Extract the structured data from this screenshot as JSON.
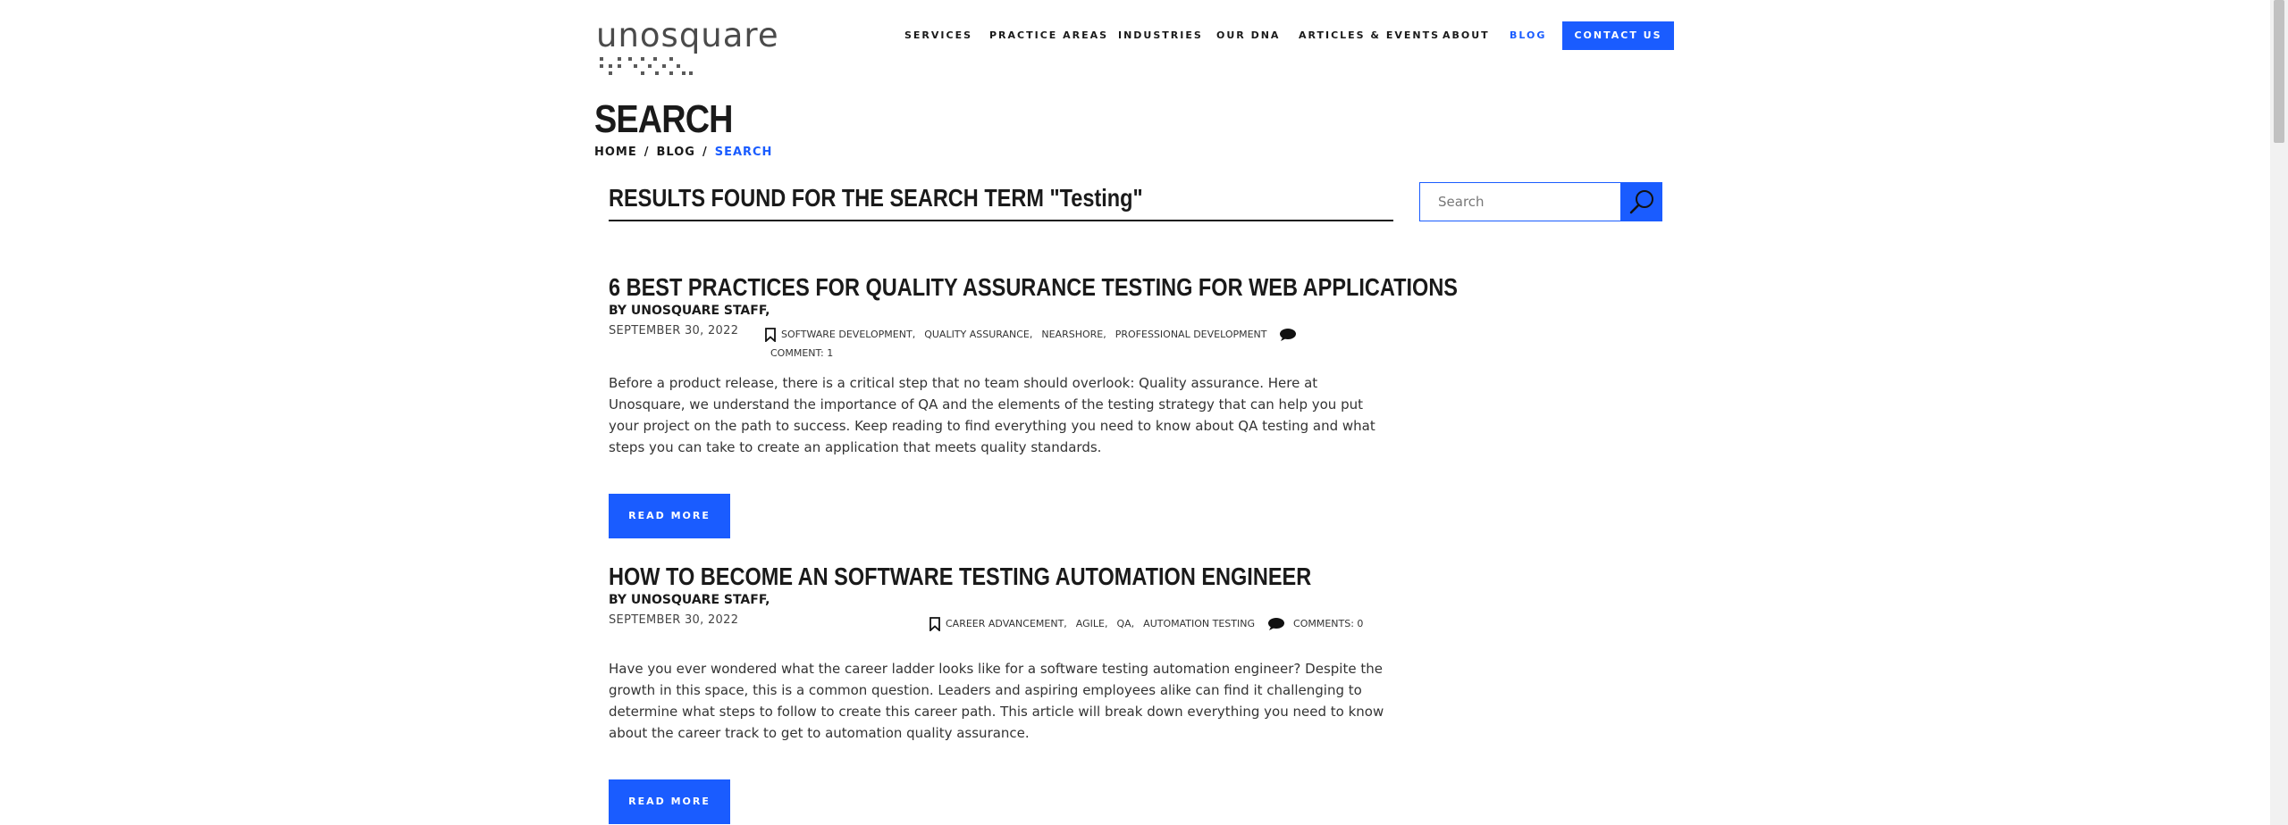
{
  "header": {
    "logo_text": "unosquare",
    "nav": [
      {
        "label": "SERVICES",
        "active": false
      },
      {
        "label": "PRACTICE AREAS",
        "active": false
      },
      {
        "label": "INDUSTRIES",
        "active": false
      },
      {
        "label": "OUR DNA",
        "active": false
      },
      {
        "label": "ARTICLES & EVENTS",
        "active": false
      },
      {
        "label": "ABOUT",
        "active": false
      },
      {
        "label": "BLOG",
        "active": true
      }
    ],
    "contact_label": "CONTACT US"
  },
  "page": {
    "title": "SEARCH",
    "breadcrumb": [
      "HOME",
      "BLOG",
      "SEARCH"
    ],
    "breadcrumb_separator": "/"
  },
  "results": {
    "heading": "RESULTS FOUND FOR THE SEARCH TERM \"Testing\""
  },
  "search": {
    "placeholder": "Search",
    "value": ""
  },
  "articles": [
    {
      "title": "6 BEST PRACTICES FOR QUALITY ASSURANCE TESTING FOR WEB APPLICATIONS",
      "byline": "BY UNOSQUARE STAFF,",
      "date": "SEPTEMBER 30, 2022",
      "tags": [
        "SOFTWARE DEVELOPMENT",
        "QUALITY ASSURANCE",
        "NEARSHORE",
        "PROFESSIONAL DEVELOPMENT"
      ],
      "comments": "COMMENT: 1",
      "excerpt": "Before a product release, there is a critical step that no team should overlook: Quality assurance. Here at Unosquare, we understand the importance of QA and the elements of the testing strategy that can help you put your project on the path to success. Keep reading to find everything you need to know about QA testing and what steps you can take to create an application that meets quality standards.",
      "read_more": "READ MORE"
    },
    {
      "title": "HOW TO BECOME AN SOFTWARE TESTING AUTOMATION ENGINEER",
      "byline": "BY UNOSQUARE STAFF,",
      "date": "SEPTEMBER 30, 2022",
      "tags": [
        "CAREER ADVANCEMENT",
        "AGILE",
        "QA",
        "AUTOMATION TESTING"
      ],
      "comments": "COMMENTS: 0",
      "excerpt": "Have you ever wondered what the career ladder looks like for a software testing automation engineer? Despite the growth in this space, this is a common question. Leaders and aspiring employees alike can find it challenging to determine what steps to follow to create this career path. This article will break down everything you need to know about the career track to get to automation quality assurance.",
      "read_more": "READ MORE"
    }
  ],
  "colors": {
    "accent": "#1a5cff",
    "text": "#1a1a1a",
    "logo": "#4b4b4b"
  },
  "icons": {
    "search": "search-icon",
    "tag": "bookmark-icon",
    "comment": "comment-icon"
  }
}
